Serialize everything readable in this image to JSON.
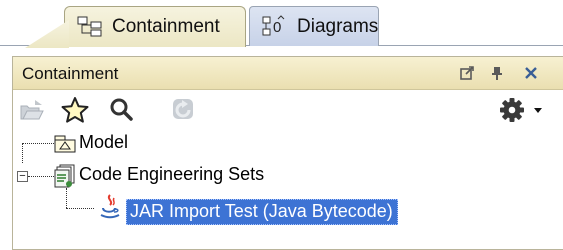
{
  "tabs": [
    {
      "label": "Containment",
      "icon": "containment-tree-icon",
      "active": true
    },
    {
      "label": "Diagrams",
      "icon": "diagrams-icon",
      "active": false
    }
  ],
  "panel": {
    "title": "Containment",
    "title_buttons": [
      "float-icon",
      "pin-icon",
      "close-icon"
    ]
  },
  "toolbar": {
    "buttons": [
      "open-folder-icon",
      "star-icon",
      "search-icon",
      "refresh-icon",
      "gear-icon"
    ]
  },
  "tree": {
    "nodes": [
      {
        "label": "Model",
        "icon": "package-icon",
        "level": 1
      },
      {
        "label": "Code Engineering Sets",
        "icon": "code-engineering-set-icon",
        "level": 1,
        "expanded": true
      },
      {
        "label": "JAR Import Test (Java Bytecode)",
        "icon": "java-icon",
        "level": 2,
        "selected": true
      }
    ]
  },
  "colors": {
    "active_tab": "#ece7c4",
    "inactive_tab": "#c7d2e8",
    "title_bar": "#eadfb0",
    "selection": "#3d73d4"
  }
}
